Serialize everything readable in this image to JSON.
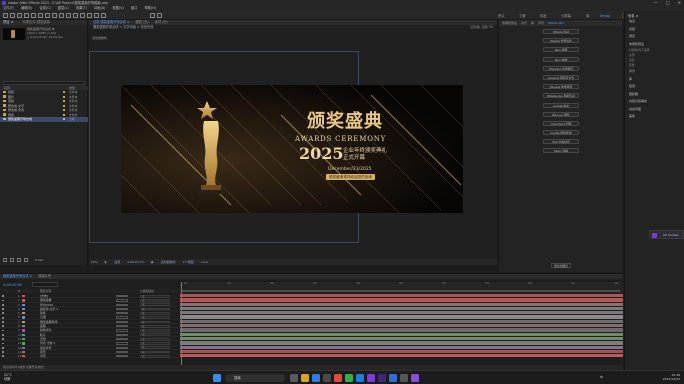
{
  "window": {
    "title": "Adobe After Effects 2025 - E:\\AE Project\\颁奖盛典开场模板.aep",
    "controls": [
      "—",
      "□",
      "✕"
    ]
  },
  "menu": [
    "文件(F)",
    "编辑(E)",
    "合成(C)",
    "图层(L)",
    "效果(T)",
    "动画(A)",
    "视图(V)",
    "窗口",
    "帮助(H)"
  ],
  "workspaces": [
    {
      "label": "默认",
      "active": false
    },
    {
      "label": "了解",
      "active": false
    },
    {
      "label": "标准",
      "active": false
    },
    {
      "label": "小屏幕",
      "active": false
    },
    {
      "label": "库",
      "active": false
    },
    {
      "label": "Xmog",
      "active": true
    }
  ],
  "search_help": {
    "placeholder": "搜索帮助"
  },
  "project": {
    "tab": "项目 ≡",
    "tab2": "效果控件 颁奖盛典",
    "comp_name": "颁奖盛典开场合成 ▼",
    "comp_info": [
      "1920 x 1080 (1.00)",
      "△ 0:00:10:00, 25.00 fps"
    ],
    "col_name": "名称",
    "col_type": "类型",
    "items": [
      {
        "name": "视频",
        "type": "文件夹",
        "color": "#c9a64a",
        "selected": false
      },
      {
        "name": "图片",
        "type": "文件夹",
        "color": "#c9a64a",
        "selected": false
      },
      {
        "name": "音频",
        "type": "文件夹",
        "color": "#c9a64a",
        "selected": false
      },
      {
        "name": "预合成-文字",
        "type": "文件夹",
        "color": "#c9a64a",
        "selected": false
      },
      {
        "name": "预合成-背景",
        "type": "文件夹",
        "color": "#c9a64a",
        "selected": false
      },
      {
        "name": "纯色",
        "type": "文件夹",
        "color": "#c9a64a",
        "selected": false
      },
      {
        "name": "颁奖盛典开场合成",
        "type": "合成",
        "color": "#a7b2c5",
        "selected": true
      }
    ],
    "bpc": "8 bpc"
  },
  "composition": {
    "tabs": [
      {
        "label": "合成 颁奖盛典开场合成 ≡",
        "active": true
      },
      {
        "label": "图层 (无)",
        "active": false
      },
      {
        "label": "素材 (无)",
        "active": false
      }
    ],
    "breadcrumb": "颁奖盛典开场合成  <  文字动画  <  背景光效",
    "renderer": "渲染器: 经典 3D",
    "active_camera": "活动摄像机",
    "footer": [
      "50%",
      "◐",
      "完整",
      "0:00:01:15",
      "▣",
      "活动摄像机",
      "1个视图",
      "+0.0"
    ]
  },
  "artwork": {
    "title_cn": "颁奖盛典",
    "title_en": "AWARDS CEREMONY",
    "year": "2025",
    "subtitle_line1": "企业年终颁奖典礼",
    "subtitle_line2": "正式开幕",
    "date": "December/23/2025",
    "venue_badge": "颁奖盛典现场欢迎您的到来"
  },
  "right_tabs": [
    {
      "label": "效果和预设",
      "active": false
    },
    {
      "label": "对齐",
      "active": false
    },
    {
      "label": "库",
      "active": false
    },
    {
      "label": "字符",
      "active": false
    },
    {
      "label": "Motion Bro",
      "active": true
    }
  ],
  "motion_buttons": [
    "Wiggle 抖动",
    "Wiggle 位置抖动",
    "Spin 旋转",
    "Spin 缩放",
    "Wiggling 位置循环",
    "Loopout 循环表达式",
    "Valueat 属性循环",
    "Wiggle-dev 随机抖动",
    "Lookat 看向",
    "Bounce 弹性",
    "Overshoot 回弹",
    "Inertia 惯性缓冲",
    "Text 文本动画",
    "Sway 摇摆"
  ],
  "motion_bottom": "添加到图层",
  "far_right": {
    "header": "信息 ≡",
    "items": [
      "信息",
      "音频",
      "预览",
      "效果和预设",
      "对齐",
      "库",
      "段落",
      "跟踪器",
      "内容识别填充",
      "动态草图",
      "画笔"
    ],
    "sub": [
      "分辨率/向下采样",
      "全部",
      "适合",
      "完整"
    ]
  },
  "plugin": {
    "label": "AE Toolbar"
  },
  "timeline": {
    "tabs": [
      {
        "label": "颁奖盛典开场合成 ≡",
        "active": true
      },
      {
        "label": "渲染队列",
        "active": false
      }
    ],
    "timecode": "0:00:00:00",
    "headers": [
      "#",
      "图层名称",
      "父级和链接"
    ],
    "layers": [
      {
        "num": "1",
        "name": "[光效]",
        "color": "#c35b5b",
        "track": "#a85656"
      },
      {
        "num": "2",
        "name": "颁奖盛典",
        "color": "#c35b5b",
        "track": "#b05a5a"
      },
      {
        "num": "3",
        "name": "年份2025",
        "color": "#6b86c7",
        "track": "#8e6e6e"
      },
      {
        "num": "4",
        "name": "副标题 文字 1",
        "color": "#6b86c7",
        "track": "#7b7b7b"
      },
      {
        "num": "5",
        "name": "奖杯",
        "color": "#b89a54",
        "track": "#7a7a7a"
      },
      {
        "num": "6",
        "name": "日期",
        "color": "#6b86c7",
        "track": "#8a8a8a"
      },
      {
        "num": "7",
        "name": "颁奖盛典现场",
        "color": "#b89a54",
        "track": "#6f6f6f"
      },
      {
        "num": "8",
        "name": "底框",
        "color": "#7e7e7e",
        "track": "#8a6a6a"
      },
      {
        "num": "9",
        "name": "斜线光条",
        "color": "#8d5fb0",
        "track": "#6b6b6b"
      },
      {
        "num": "10",
        "name": "粒子",
        "color": "#55a06a",
        "track": "#6f8c6f"
      },
      {
        "num": "11",
        "name": "光斑",
        "color": "#55a06a",
        "track": "#6f8c6f"
      },
      {
        "num": "12",
        "name": "背景 光效 1",
        "color": "#55a06a",
        "track": "#7c7c7c"
      },
      {
        "num": "13",
        "name": "渐变背景",
        "color": "#8d5fb0",
        "track": "#8a6b8a"
      },
      {
        "num": "14",
        "name": "音乐",
        "color": "#7e7e7e",
        "track": "#a05454"
      },
      {
        "num": "15",
        "name": "背景",
        "color": "#c35b5b",
        "track": "#b85c5c"
      }
    ],
    "parent_value": "无",
    "ticks": [
      "0s",
      "01s",
      "02s",
      "03s",
      "04s",
      "05s",
      "06s",
      "07s",
      "08s",
      "09s",
      "10s"
    ],
    "footer": "帧渲染时间 0毫秒   切换开关/模式"
  },
  "taskbar": {
    "weather": "22°C",
    "weather_desc": "晴朗",
    "search": "搜索",
    "time": "15:48",
    "date": "2024/12/23",
    "lang": "中"
  }
}
